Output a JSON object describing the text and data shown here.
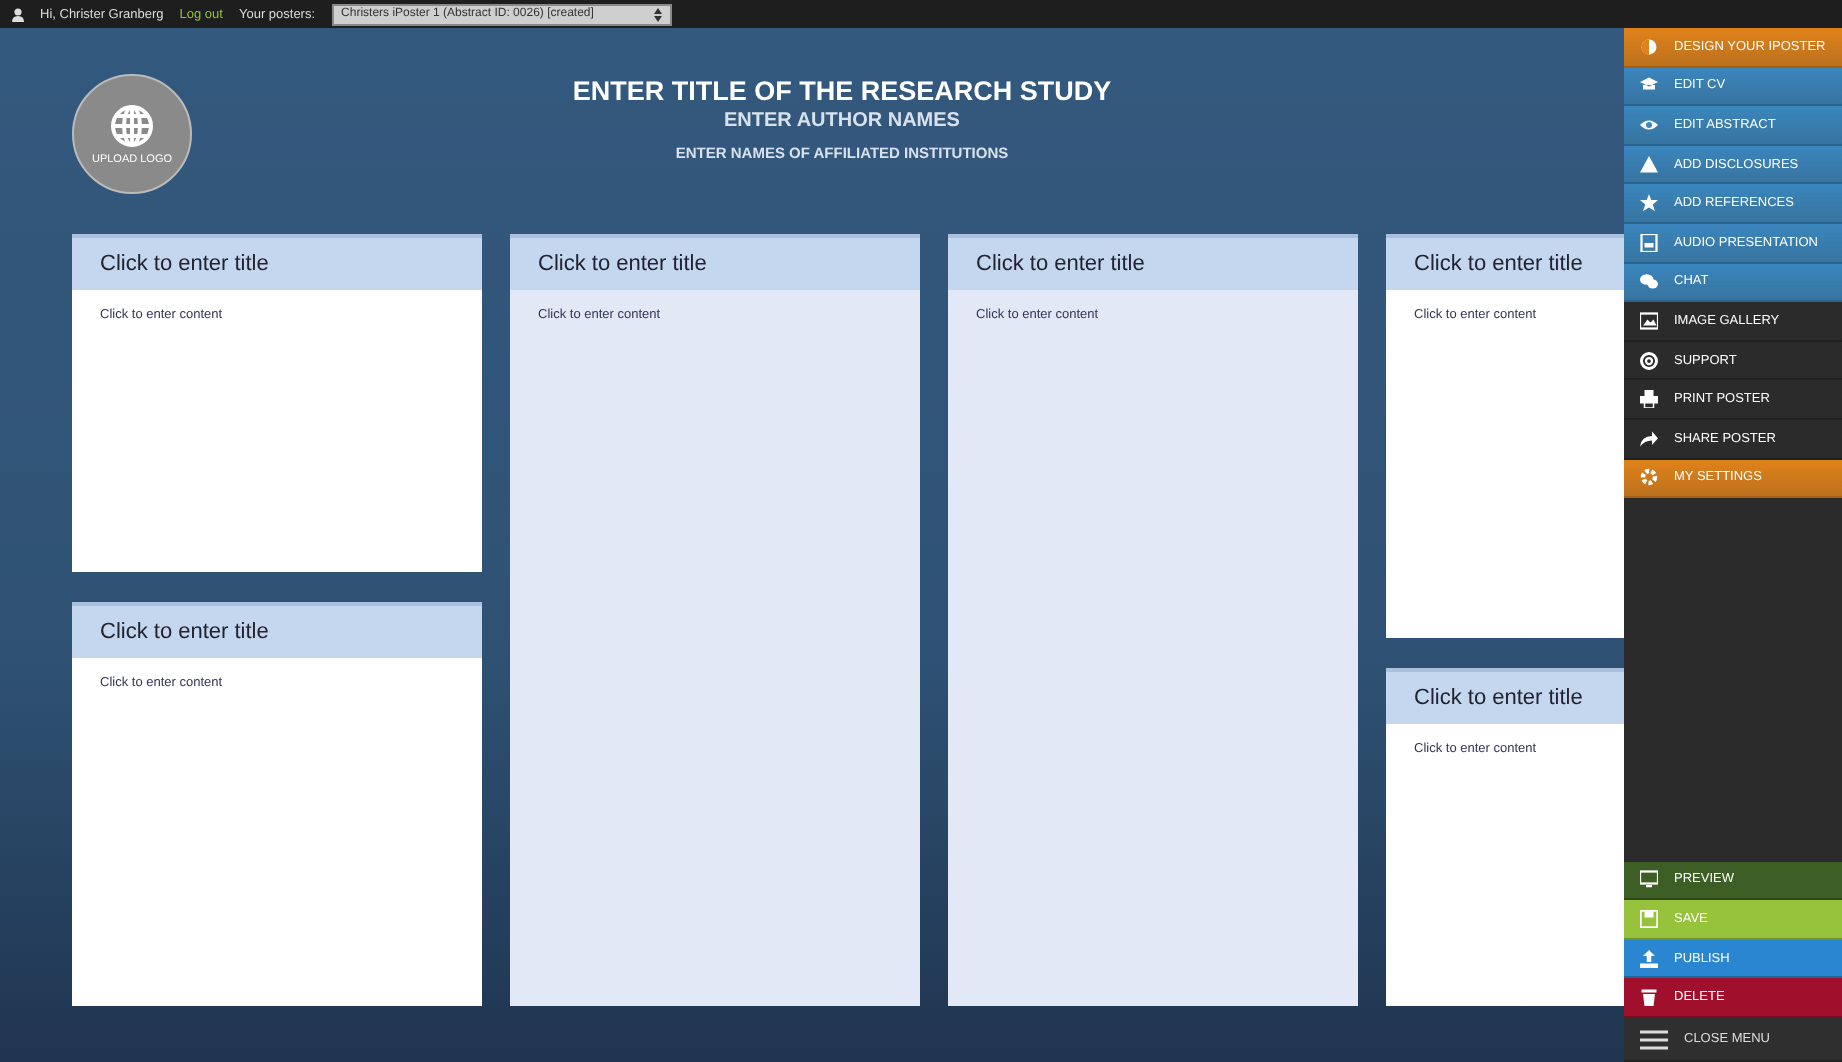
{
  "top_bar": {
    "greeting": "Hi, Christer Granberg",
    "logout": "Log out",
    "posters_label": "Your posters:",
    "poster_select": "Christers iPoster 1 (Abstract ID: 0026) [created]"
  },
  "header": {
    "logo_label": "UPLOAD LOGO",
    "title": "ENTER TITLE OF THE RESEARCH STUDY",
    "authors": "ENTER AUTHOR NAMES",
    "institutions": "ENTER NAMES OF AFFILIATED INSTITUTIONS"
  },
  "columns": [
    {
      "panels": [
        {
          "title": "Click to enter title",
          "content": "Click to enter content"
        },
        {
          "title": "Click to enter title",
          "content": "Click to enter content"
        }
      ]
    },
    {
      "panels": [
        {
          "title": "Click to enter title",
          "content": "Click to enter content"
        }
      ]
    },
    {
      "panels": [
        {
          "title": "Click to enter title",
          "content": "Click to enter content"
        }
      ]
    },
    {
      "panels": [
        {
          "title": "Click to enter title",
          "content": "Click to enter content"
        },
        {
          "title": "Click to enter title",
          "content": "Click to enter content"
        }
      ]
    }
  ],
  "menu": {
    "items": [
      {
        "label": "DESIGN YOUR IPOSTER",
        "color": "#e0821a"
      },
      {
        "label": "EDIT CV",
        "color": "#3a86bd"
      },
      {
        "label": "EDIT ABSTRACT",
        "color": "#3a86bd"
      },
      {
        "label": "ADD DISCLOSURES",
        "color": "#3a86bd"
      },
      {
        "label": "ADD REFERENCES",
        "color": "#3a86bd"
      },
      {
        "label": "AUDIO PRESENTATION",
        "color": "#3a86bd"
      },
      {
        "label": "CHAT",
        "color": "#3a86bd"
      },
      {
        "label": "IMAGE GALLERY",
        "color": "#2b2b2b"
      },
      {
        "label": "SUPPORT",
        "color": "#2b2b2b"
      },
      {
        "label": "PRINT POSTER",
        "color": "#2b2b2b"
      },
      {
        "label": "SHARE POSTER",
        "color": "#2b2b2b"
      },
      {
        "label": "MY SETTINGS",
        "color": "#e0821a"
      }
    ],
    "actions": [
      {
        "label": "PREVIEW",
        "color": "#3d5f25"
      },
      {
        "label": "SAVE",
        "color": "#97c23c"
      },
      {
        "label": "PUBLISH",
        "color": "#2a86d0"
      },
      {
        "label": "DELETE",
        "color": "#a0102c"
      }
    ],
    "close": "CLOSE MENU"
  }
}
